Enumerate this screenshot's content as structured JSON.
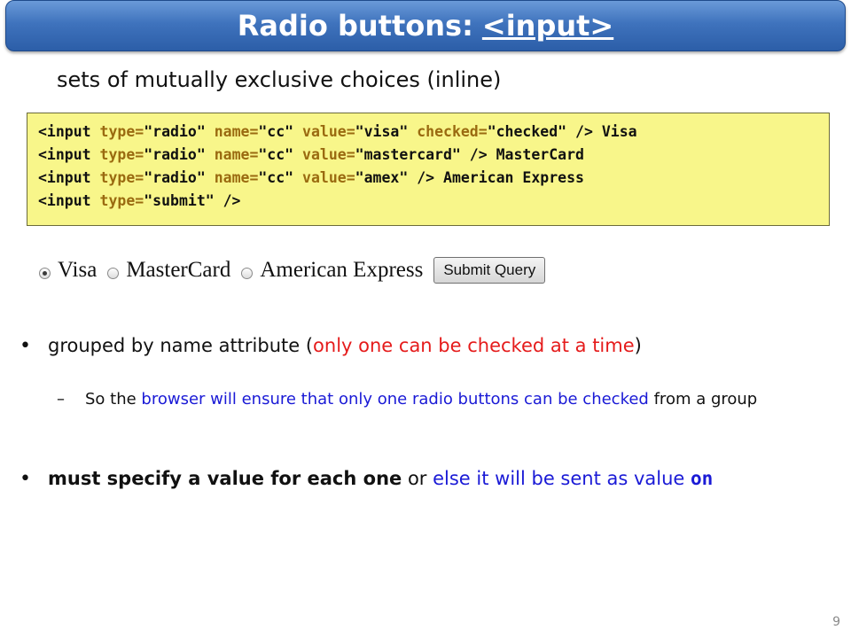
{
  "title": {
    "text": "Radio buttons:",
    "link": "<input>"
  },
  "subtitle": "sets of mutually exclusive choices (inline)",
  "code": {
    "lines": [
      {
        "lt": "<input ",
        "a1": "type=",
        "v1": "\"radio\" ",
        "a2": "name=",
        "v2": "\"cc\" ",
        "a3": "value=",
        "v3": "\"visa\" ",
        "a4": "checked=",
        "v4": "\"checked\" ",
        "tail": "/> Visa"
      },
      {
        "lt": "<input ",
        "a1": "type=",
        "v1": "\"radio\" ",
        "a2": "name=",
        "v2": "\"cc\" ",
        "a3": "value=",
        "v3": "\"mastercard\" ",
        "tail": "/> MasterCard"
      },
      {
        "lt": "<input ",
        "a1": "type=",
        "v1": "\"radio\" ",
        "a2": "name=",
        "v2": "\"cc\" ",
        "a3": "value=",
        "v3": "\"amex\" ",
        "tail": "/> American Express"
      },
      {
        "lt": "<input ",
        "a1": "type=",
        "v1": "\"submit\" ",
        "tail": "/>"
      }
    ]
  },
  "demo": {
    "options": [
      {
        "label": "Visa",
        "checked": true
      },
      {
        "label": "MasterCard",
        "checked": false
      },
      {
        "label": "American Express",
        "checked": false
      }
    ],
    "submit_label": "Submit Query"
  },
  "bullets": {
    "b1": {
      "pre": "grouped by name attribute (",
      "red": "only one can be checked at a time",
      "post": ")"
    },
    "sub1": {
      "pre": "So the ",
      "blue": "browser will ensure that only one radio buttons can be checked",
      "post": " from a group"
    },
    "b2": {
      "bold": "must specify a value for each one",
      "mid": " or ",
      "blue": "else it will be sent as value ",
      "code": "on"
    }
  },
  "page_number": "9",
  "colors": {
    "title_bg": "#3f73bd",
    "code_bg": "#f8f68a",
    "red": "#e51b1b",
    "blue": "#1a1ad6"
  }
}
